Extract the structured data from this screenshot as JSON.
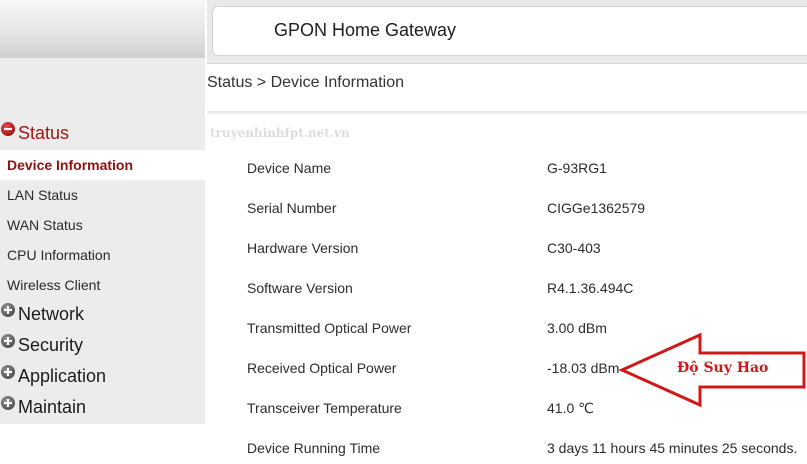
{
  "header": {
    "title": "GPON Home Gateway"
  },
  "breadcrumb": "Status > Device Information",
  "watermark": "truyenhinhfpt.net.vn",
  "sidebar": {
    "status": {
      "label": "Status",
      "icon": "minus-circle-icon",
      "items": [
        "Device Information",
        "LAN Status",
        "WAN Status",
        "CPU Information",
        "Wireless Client"
      ]
    },
    "groups": [
      {
        "label": "Network",
        "icon": "plus-circle-icon"
      },
      {
        "label": "Security",
        "icon": "plus-circle-icon"
      },
      {
        "label": "Application",
        "icon": "plus-circle-icon"
      },
      {
        "label": "Maintain",
        "icon": "plus-circle-icon"
      }
    ]
  },
  "device_info": [
    {
      "label": "Device Name",
      "value": "G-93RG1"
    },
    {
      "label": "Serial Number",
      "value": "CIGGe1362579"
    },
    {
      "label": "Hardware Version",
      "value": "C30-403"
    },
    {
      "label": "Software Version",
      "value": "R4.1.36.494C"
    },
    {
      "label": "Transmitted Optical Power",
      "value": "3.00 dBm"
    },
    {
      "label": "Received Optical Power",
      "value": "-18.03 dBm"
    },
    {
      "label": "Transceiver Temperature",
      "value": "41.0 ℃"
    },
    {
      "label": "Device Running Time",
      "value": "3 days 11 hours 45 minutes 25 seconds."
    }
  ],
  "annotation": {
    "text": "Độ Suy Hao",
    "color": "#d01818"
  },
  "colors": {
    "active_menu": "#a21616",
    "selected_item": "#8b1212",
    "sidebar_bg": "#ececec"
  }
}
